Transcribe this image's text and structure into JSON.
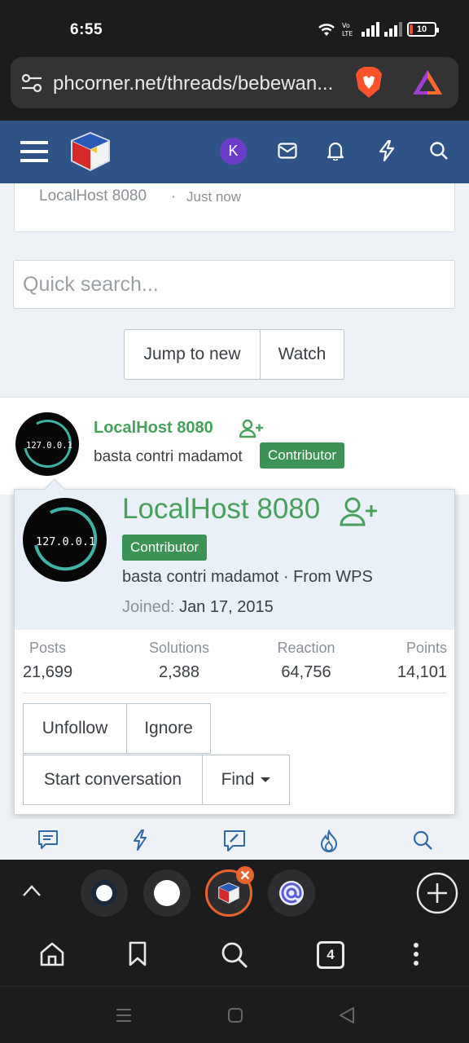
{
  "status_bar": {
    "time": "6:55",
    "battery": "10"
  },
  "browser": {
    "url": "phcorner.net/threads/bebewan..."
  },
  "site_header": {
    "avatar_letter": "K"
  },
  "previous_card": {
    "username": "LocalHost 8080",
    "separator": "·",
    "time": "Just now"
  },
  "search": {
    "placeholder": "Quick search..."
  },
  "thread_actions": {
    "jump_label": "Jump to new",
    "watch_label": "Watch"
  },
  "post": {
    "username": "LocalHost 8080",
    "user_title": "basta contri madamot",
    "badge": "Contributor",
    "avatar_text": "127.0.0.1"
  },
  "member_popup": {
    "username": "LocalHost 8080",
    "badge": "Contributor",
    "title_line": "basta contri madamot · From WPS",
    "joined_label": "Joined:",
    "joined_date": "Jan 17, 2015",
    "stats": [
      {
        "label": "Posts",
        "value": "21,699"
      },
      {
        "label": "Solutions",
        "value": "2,388"
      },
      {
        "label": "Reaction",
        "value": "64,756"
      },
      {
        "label": "Points",
        "value": "14,101"
      }
    ],
    "unfollow_label": "Unfollow",
    "ignore_label": "Ignore",
    "start_conversation_label": "Start conversation",
    "find_label": "Find"
  },
  "browser_bottom": {
    "tab_count": "4"
  },
  "colors": {
    "header_blue": "#2e5487",
    "username_green": "#47a05b",
    "badge_green": "#3c9355",
    "avatar_purple": "#6b3cc9",
    "active_tab_ring": "#e8642a"
  }
}
